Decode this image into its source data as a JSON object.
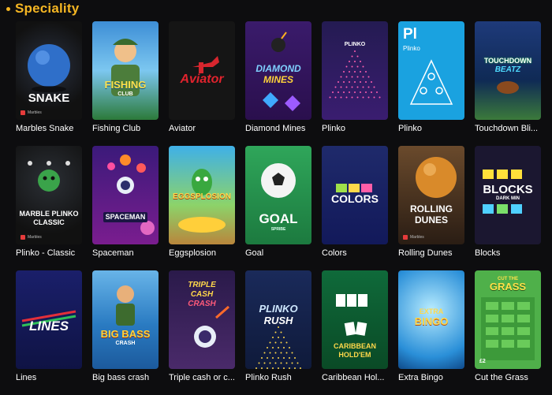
{
  "section": {
    "title": "Speciality"
  },
  "games": [
    {
      "name": "Marbles Snake",
      "art": "SNAKE",
      "provider": "Marbles"
    },
    {
      "name": "Fishing Club",
      "art": "FISHING",
      "art2": "CLUB"
    },
    {
      "name": "Aviator",
      "art": "Aviator"
    },
    {
      "name": "Diamond Mines",
      "art": "DIAMOND",
      "art2": "MINES"
    },
    {
      "name": "Plinko",
      "art": "PLINKO"
    },
    {
      "name": "Plinko",
      "art": "Pl",
      "art2": "Plinko"
    },
    {
      "name": "Touchdown Bli...",
      "art": "TOUCHDOWN",
      "art2": "BEATZ"
    },
    {
      "name": "Plinko - Classic",
      "art": "MARBLE PLINKO",
      "art2": "CLASSIC",
      "provider": "Marbles"
    },
    {
      "name": "Spaceman",
      "art": "SPACEMAN"
    },
    {
      "name": "Eggsplosion",
      "art": "EGGSPLOSION"
    },
    {
      "name": "Goal",
      "art": "GOAL",
      "art2": "SPRIBE"
    },
    {
      "name": "Colors",
      "art": "COLORS"
    },
    {
      "name": "Rolling Dunes",
      "art": "ROLLING",
      "art2": "DUNES",
      "provider": "Marbles"
    },
    {
      "name": "Blocks",
      "art": "BLOCKS",
      "art2": "DARK MIN"
    },
    {
      "name": "Lines",
      "art": "LINES"
    },
    {
      "name": "Big bass crash",
      "art": "BIG BASS",
      "art2": "CRASH"
    },
    {
      "name": "Triple cash or c...",
      "art": "TRIPLE",
      "art2": "CASH",
      "art3": "CRASH"
    },
    {
      "name": "Plinko Rush",
      "art": "PLINKO",
      "art2": "RUSH"
    },
    {
      "name": "Caribbean Hol...",
      "art": "CARIBBEAN",
      "art2": "HOLD'EM"
    },
    {
      "name": "Extra Bingo",
      "art": "EXTRA",
      "art2": "BINGO"
    },
    {
      "name": "Cut the Grass",
      "art": "CUT THE",
      "art2": "GRASS",
      "art3": "£2"
    }
  ]
}
